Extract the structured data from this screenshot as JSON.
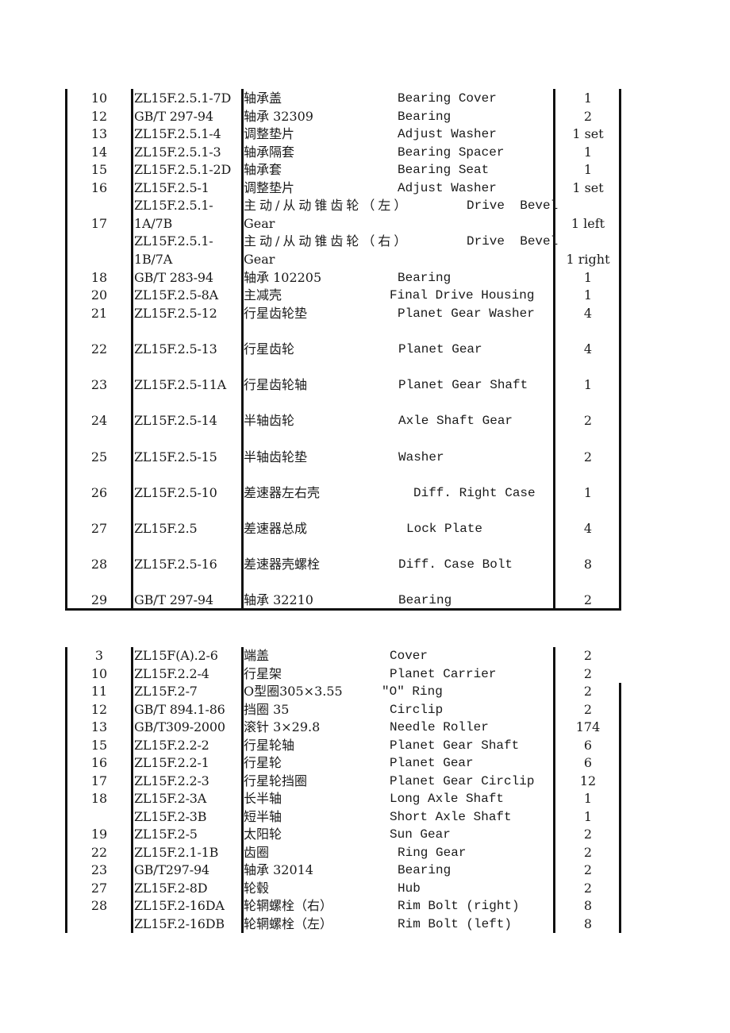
{
  "table1": {
    "rows": [
      {
        "no": "10",
        "code": "ZL15F.2.5.1-7D",
        "cn": "轴承盖",
        "en": "Bearing Cover",
        "qty": "1"
      },
      {
        "no": "12",
        "code": "GB/T 297-94",
        "cn": "轴承 32309",
        "en": "Bearing",
        "qty": "2"
      },
      {
        "no": "13",
        "code": "ZL15F.2.5.1-4",
        "cn": "调整垫片",
        "en": "Adjust Washer",
        "qty": "1 set"
      },
      {
        "no": "14",
        "code": "ZL15F.2.5.1-3",
        "cn": "轴承隔套",
        "en": "Bearing Spacer",
        "qty": "1"
      },
      {
        "no": "15",
        "code": "ZL15F.2.5.1-2D",
        "cn": "轴承套",
        "en": "Bearing Seat",
        "qty": "1"
      },
      {
        "no": "16",
        "code": "ZL15F.2.5-1",
        "cn": "调整垫片",
        "en": "Adjust Washer",
        "qty": "1 set"
      },
      {
        "no": "17",
        "code_l1": "ZL15F.2.5.1-",
        "code_l2": "1A/7B",
        "cn_l1": "主动/从动锥齿轮（左）",
        "en_l1": "Drive  Bevel",
        "cn_l2": "Gear",
        "qty": "1 left"
      },
      {
        "no": "",
        "code_l1": "ZL15F.2.5.1-",
        "code_l2": "1B/7A",
        "cn_l1": "主动/从动锥齿轮（右）",
        "en_l1": "Drive  Bevel",
        "cn_l2": "Gear",
        "qty": "1 right"
      },
      {
        "no": "18",
        "code": "GB/T 283-94",
        "cn": "轴承 102205",
        "en": "Bearing",
        "qty": "1"
      },
      {
        "no": "20",
        "code": "ZL15F.2.5-8A",
        "cn": "主减壳",
        "en": "Final Drive Housing",
        "qty": "1"
      },
      {
        "no": "21",
        "code": "ZL15F.2.5-12",
        "cn": "行星齿轮垫",
        "en": "Planet Gear Washer",
        "qty": "4"
      },
      {
        "no": "22",
        "code": "ZL15F.2.5-13",
        "cn": "行星齿轮",
        "en": "Planet Gear",
        "qty": "4"
      },
      {
        "no": "23",
        "code": "ZL15F.2.5-11A",
        "cn": "行星齿轮轴",
        "en": "Planet Gear Shaft",
        "qty": "1"
      },
      {
        "no": "24",
        "code": "ZL15F.2.5-14",
        "cn": "半轴齿轮",
        "en": "Axle Shaft Gear",
        "qty": "2"
      },
      {
        "no": "25",
        "code": "ZL15F.2.5-15",
        "cn": "半轴齿轮垫",
        "en": "Washer",
        "qty": "2"
      },
      {
        "no": "26",
        "code": "ZL15F.2.5-10",
        "cn": "差速器左右壳",
        "en": "Diff. Right Case",
        "qty": "1"
      },
      {
        "no": "27",
        "code": "ZL15F.2.5",
        "cn": "差速器总成",
        "en": "Lock Plate",
        "qty": "4"
      },
      {
        "no": "28",
        "code": "ZL15F.2.5-16",
        "cn": "差速器壳螺栓",
        "en": "Diff. Case Bolt",
        "qty": "8"
      },
      {
        "no": "29",
        "code": "GB/T 297-94",
        "cn": "轴承 32210",
        "en": "Bearing",
        "qty": "2"
      }
    ]
  },
  "table2": {
    "rows": [
      {
        "no": "3",
        "code": "ZL15F(A).2-6",
        "cn": "端盖",
        "en": "Cover",
        "qty": "2"
      },
      {
        "no": "10",
        "code": "ZL15F.2.2-4",
        "cn": "行星架",
        "en": "Planet Carrier",
        "qty": "2"
      },
      {
        "no": "11",
        "code": "ZL15F.2-7",
        "cn": "O型圈305×3.55",
        "en": "\"O\" Ring",
        "qty": "2"
      },
      {
        "no": "12",
        "code": "GB/T 894.1-86",
        "cn": "挡圈 35",
        "en": "Circlip",
        "qty": "2"
      },
      {
        "no": "13",
        "code": "GB/T309-2000",
        "cn": "滚针 3×29.8",
        "en": "Needle Roller",
        "qty": "174"
      },
      {
        "no": "15",
        "code": "ZL15F.2.2-2",
        "cn": "行星轮轴",
        "en": "Planet Gear Shaft",
        "qty": "6"
      },
      {
        "no": "16",
        "code": "ZL15F.2.2-1",
        "cn": "行星轮",
        "en": "Planet Gear",
        "qty": "6"
      },
      {
        "no": "17",
        "code": "ZL15F.2.2-3",
        "cn": "行星轮挡圈",
        "en": "Planet Gear Circlip",
        "qty": "12"
      },
      {
        "no": "18",
        "code": "ZL15F.2-3A",
        "cn": "长半轴",
        "en": "Long Axle Shaft",
        "qty": "1"
      },
      {
        "no": "",
        "code": "ZL15F.2-3B",
        "cn": "短半轴",
        "en": "Short Axle Shaft",
        "qty": "1"
      },
      {
        "no": "19",
        "code": "ZL15F.2-5",
        "cn": "太阳轮",
        "en": "Sun Gear",
        "qty": "2"
      },
      {
        "no": "22",
        "code": "ZL15F.2.1-1B",
        "cn": "齿圈",
        "en": "Ring Gear",
        "qty": "2"
      },
      {
        "no": "23",
        "code": "GB/T297-94",
        "cn": "轴承 32014",
        "en": "Bearing",
        "qty": "2"
      },
      {
        "no": "27",
        "code": "ZL15F.2-8D",
        "cn": "轮毂",
        "en": "Hub",
        "qty": "2"
      },
      {
        "no": "28",
        "code": "ZL15F.2-16DA",
        "cn": "轮辋螺栓（右）",
        "en": "Rim Bolt (right)",
        "qty": "8"
      },
      {
        "no": "",
        "code": "ZL15F.2-16DB",
        "cn": "轮辋螺栓（左）",
        "en": "Rim Bolt (left)",
        "qty": "8"
      }
    ]
  }
}
